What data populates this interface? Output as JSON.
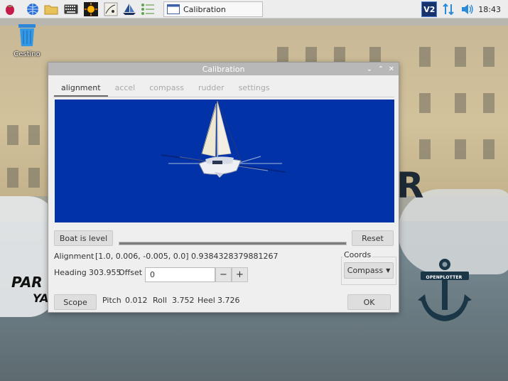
{
  "taskbar": {
    "task_title": "Calibration",
    "vnc_label": "V2",
    "clock": "18:43",
    "icons": [
      "raspberry-menu-icon",
      "web-browser-icon",
      "file-manager-icon",
      "keyboard-icon",
      "sun-icon",
      "map-icon",
      "openplotter-icon",
      "settings-list-icon"
    ]
  },
  "desktop": {
    "trash_label": "Cestino",
    "wallpaper_brand_1": "PAR",
    "wallpaper_brand_2": "YA",
    "wallpaper_logo_text": "OPENPLOTTER"
  },
  "dialog": {
    "title": "Calibration",
    "tabs": [
      {
        "label": "alignment",
        "active": true
      },
      {
        "label": "accel",
        "active": false
      },
      {
        "label": "compass",
        "active": false
      },
      {
        "label": "rudder",
        "active": false
      },
      {
        "label": "settings",
        "active": false
      }
    ],
    "viewport_bg": "#0232a8",
    "boat_is_level_label": "Boat is level",
    "reset_label": "Reset",
    "level_progress": 1.0,
    "alignment_label": "Alignment",
    "alignment_value": "[1.0, 0.006, -0.005, 0.0] 0.9384328379881267",
    "heading_label": "Heading",
    "heading_value": "303.955",
    "offset_label": "Offset",
    "offset_value": "0",
    "minus_label": "−",
    "plus_label": "+",
    "coords_label": "Coords",
    "coords_selected": "Compass",
    "scope_label": "Scope",
    "pitch_label": "Pitch",
    "pitch_value": "0.012",
    "roll_label": "Roll",
    "roll_value": "3.752",
    "heel_label": "Heel",
    "heel_value": "3.726",
    "ok_label": "OK"
  }
}
